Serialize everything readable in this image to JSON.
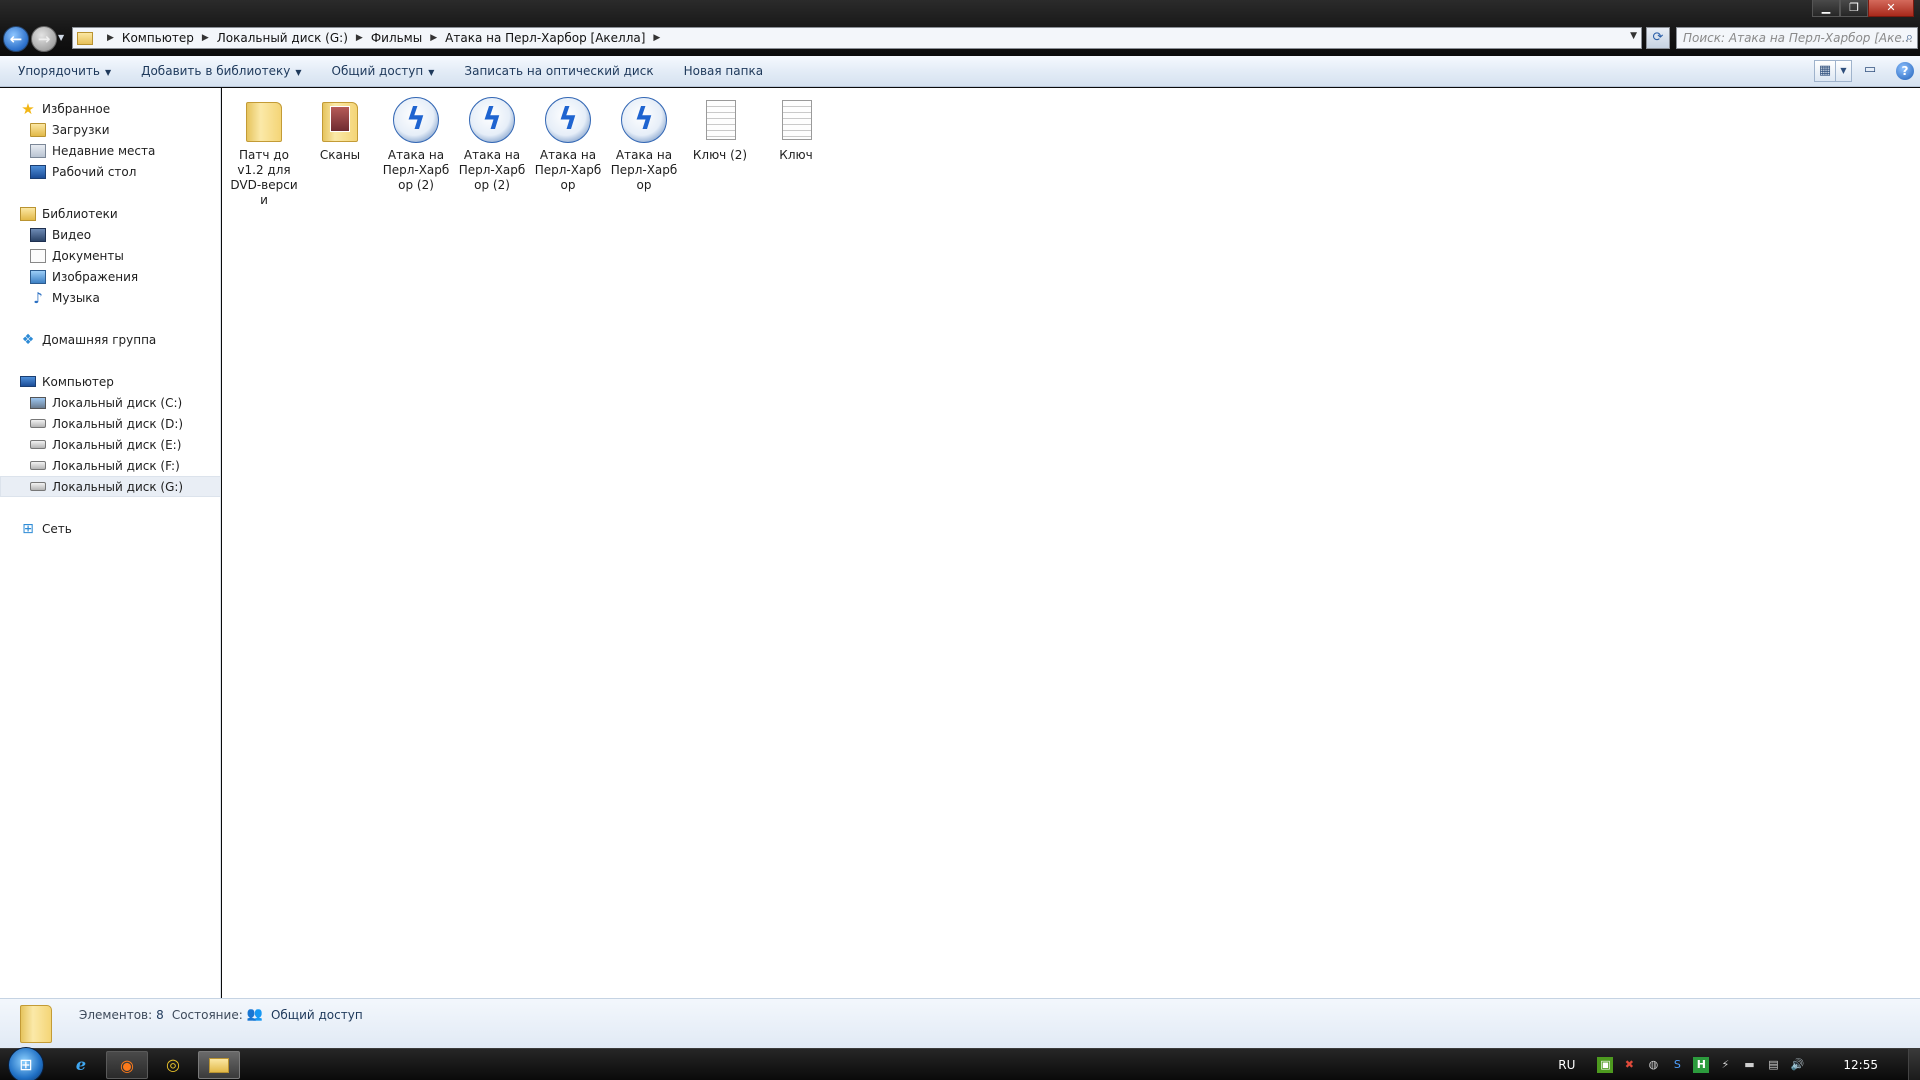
{
  "window": {
    "minimize": "▁",
    "maximize": "❐",
    "close": "✕"
  },
  "address": {
    "crumbs": [
      "Компьютер",
      "Локальный диск (G:)",
      "Фильмы",
      "Атака на Перл-Харбор [Акелла]"
    ],
    "search_placeholder": "Поиск: Атака на Перл-Харбор [Аке..."
  },
  "toolbar": {
    "organize": "Упорядочить",
    "add_to_library": "Добавить в библиотеку",
    "share": "Общий доступ",
    "burn": "Записать на оптический диск",
    "new_folder": "Новая папка",
    "help": "?"
  },
  "sidebar": {
    "favorites": "Избранное",
    "downloads": "Загрузки",
    "recent": "Недавние места",
    "desktop": "Рабочий стол",
    "libraries": "Библиотеки",
    "video": "Видео",
    "documents": "Документы",
    "pictures": "Изображения",
    "music": "Музыка",
    "homegroup": "Домашняя группа",
    "computer": "Компьютер",
    "drive_c": "Локальный диск (C:)",
    "drive_d": "Локальный диск (D:)",
    "drive_e": "Локальный диск (E:)",
    "drive_f": "Локальный диск (F:)",
    "drive_g": "Локальный диск (G:)",
    "network": "Сеть"
  },
  "files": [
    {
      "label": "Патч до v1.2 для DVD-верси и",
      "icon": "folder-icon"
    },
    {
      "label": "Сканы",
      "icon": "folder-photos-icon"
    },
    {
      "label": "Атака на Перл-Харб ор (2)",
      "icon": "daemon-tools-image-icon"
    },
    {
      "label": "Атака на Перл-Харб ор (2)",
      "icon": "daemon-tools-image-icon"
    },
    {
      "label": "Атака на Перл-Харб ор",
      "icon": "daemon-tools-image-icon"
    },
    {
      "label": "Атака на Перл-Харб ор",
      "icon": "daemon-tools-image-icon"
    },
    {
      "label": "Ключ (2)",
      "icon": "text-file-icon"
    },
    {
      "label": "Ключ",
      "icon": "text-file-icon"
    }
  ],
  "details": {
    "items_label": "Элементов:",
    "items_count": "8",
    "state_label": "Состояние:",
    "state_value": "Общий доступ"
  },
  "taskbar": {
    "lang": "RU",
    "clock": "12:55"
  }
}
